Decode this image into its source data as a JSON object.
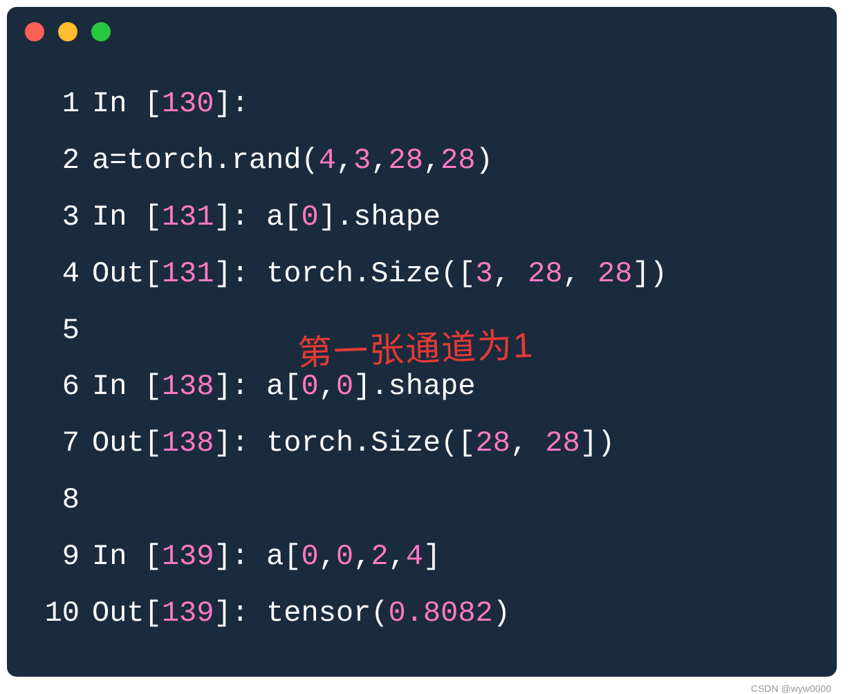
{
  "lines": [
    {
      "num": "1",
      "segments": [
        {
          "t": "In [",
          "c": "white"
        },
        {
          "t": "130",
          "c": "pink"
        },
        {
          "t": "]:",
          "c": "white"
        }
      ]
    },
    {
      "num": "2",
      "segments": [
        {
          "t": "a=torch.rand(",
          "c": "white"
        },
        {
          "t": "4",
          "c": "pink"
        },
        {
          "t": ",",
          "c": "white"
        },
        {
          "t": "3",
          "c": "pink"
        },
        {
          "t": ",",
          "c": "white"
        },
        {
          "t": "28",
          "c": "pink"
        },
        {
          "t": ",",
          "c": "white"
        },
        {
          "t": "28",
          "c": "pink"
        },
        {
          "t": ")",
          "c": "white"
        }
      ]
    },
    {
      "num": "3",
      "segments": [
        {
          "t": "In [",
          "c": "white"
        },
        {
          "t": "131",
          "c": "pink"
        },
        {
          "t": "]: a[",
          "c": "white"
        },
        {
          "t": "0",
          "c": "pink"
        },
        {
          "t": "].shape",
          "c": "white"
        }
      ]
    },
    {
      "num": "4",
      "segments": [
        {
          "t": "Out[",
          "c": "white"
        },
        {
          "t": "131",
          "c": "pink"
        },
        {
          "t": "]: torch.Size([",
          "c": "white"
        },
        {
          "t": "3",
          "c": "pink"
        },
        {
          "t": ", ",
          "c": "white"
        },
        {
          "t": "28",
          "c": "pink"
        },
        {
          "t": ", ",
          "c": "white"
        },
        {
          "t": "28",
          "c": "pink"
        },
        {
          "t": "])",
          "c": "white"
        }
      ]
    },
    {
      "num": "5",
      "segments": []
    },
    {
      "num": "6",
      "segments": [
        {
          "t": "In [",
          "c": "white"
        },
        {
          "t": "138",
          "c": "pink"
        },
        {
          "t": "]: a[",
          "c": "white"
        },
        {
          "t": "0",
          "c": "pink"
        },
        {
          "t": ",",
          "c": "white"
        },
        {
          "t": "0",
          "c": "pink"
        },
        {
          "t": "].shape",
          "c": "white"
        }
      ]
    },
    {
      "num": "7",
      "segments": [
        {
          "t": "Out[",
          "c": "white"
        },
        {
          "t": "138",
          "c": "pink"
        },
        {
          "t": "]: torch.Size([",
          "c": "white"
        },
        {
          "t": "28",
          "c": "pink"
        },
        {
          "t": ", ",
          "c": "white"
        },
        {
          "t": "28",
          "c": "pink"
        },
        {
          "t": "])",
          "c": "white"
        }
      ]
    },
    {
      "num": "8",
      "segments": []
    },
    {
      "num": "9",
      "segments": [
        {
          "t": "In [",
          "c": "white"
        },
        {
          "t": "139",
          "c": "pink"
        },
        {
          "t": "]: a[",
          "c": "white"
        },
        {
          "t": "0",
          "c": "pink"
        },
        {
          "t": ",",
          "c": "white"
        },
        {
          "t": "0",
          "c": "pink"
        },
        {
          "t": ",",
          "c": "white"
        },
        {
          "t": "2",
          "c": "pink"
        },
        {
          "t": ",",
          "c": "white"
        },
        {
          "t": "4",
          "c": "pink"
        },
        {
          "t": "]",
          "c": "white"
        }
      ]
    },
    {
      "num": "10",
      "segments": [
        {
          "t": "Out[",
          "c": "white"
        },
        {
          "t": "139",
          "c": "pink"
        },
        {
          "t": "]: tensor(",
          "c": "white"
        },
        {
          "t": "0.8082",
          "c": "pink"
        },
        {
          "t": ")",
          "c": "white"
        }
      ]
    }
  ],
  "annotation": "第一张通道为1",
  "watermark": "CSDN @wyw0000"
}
